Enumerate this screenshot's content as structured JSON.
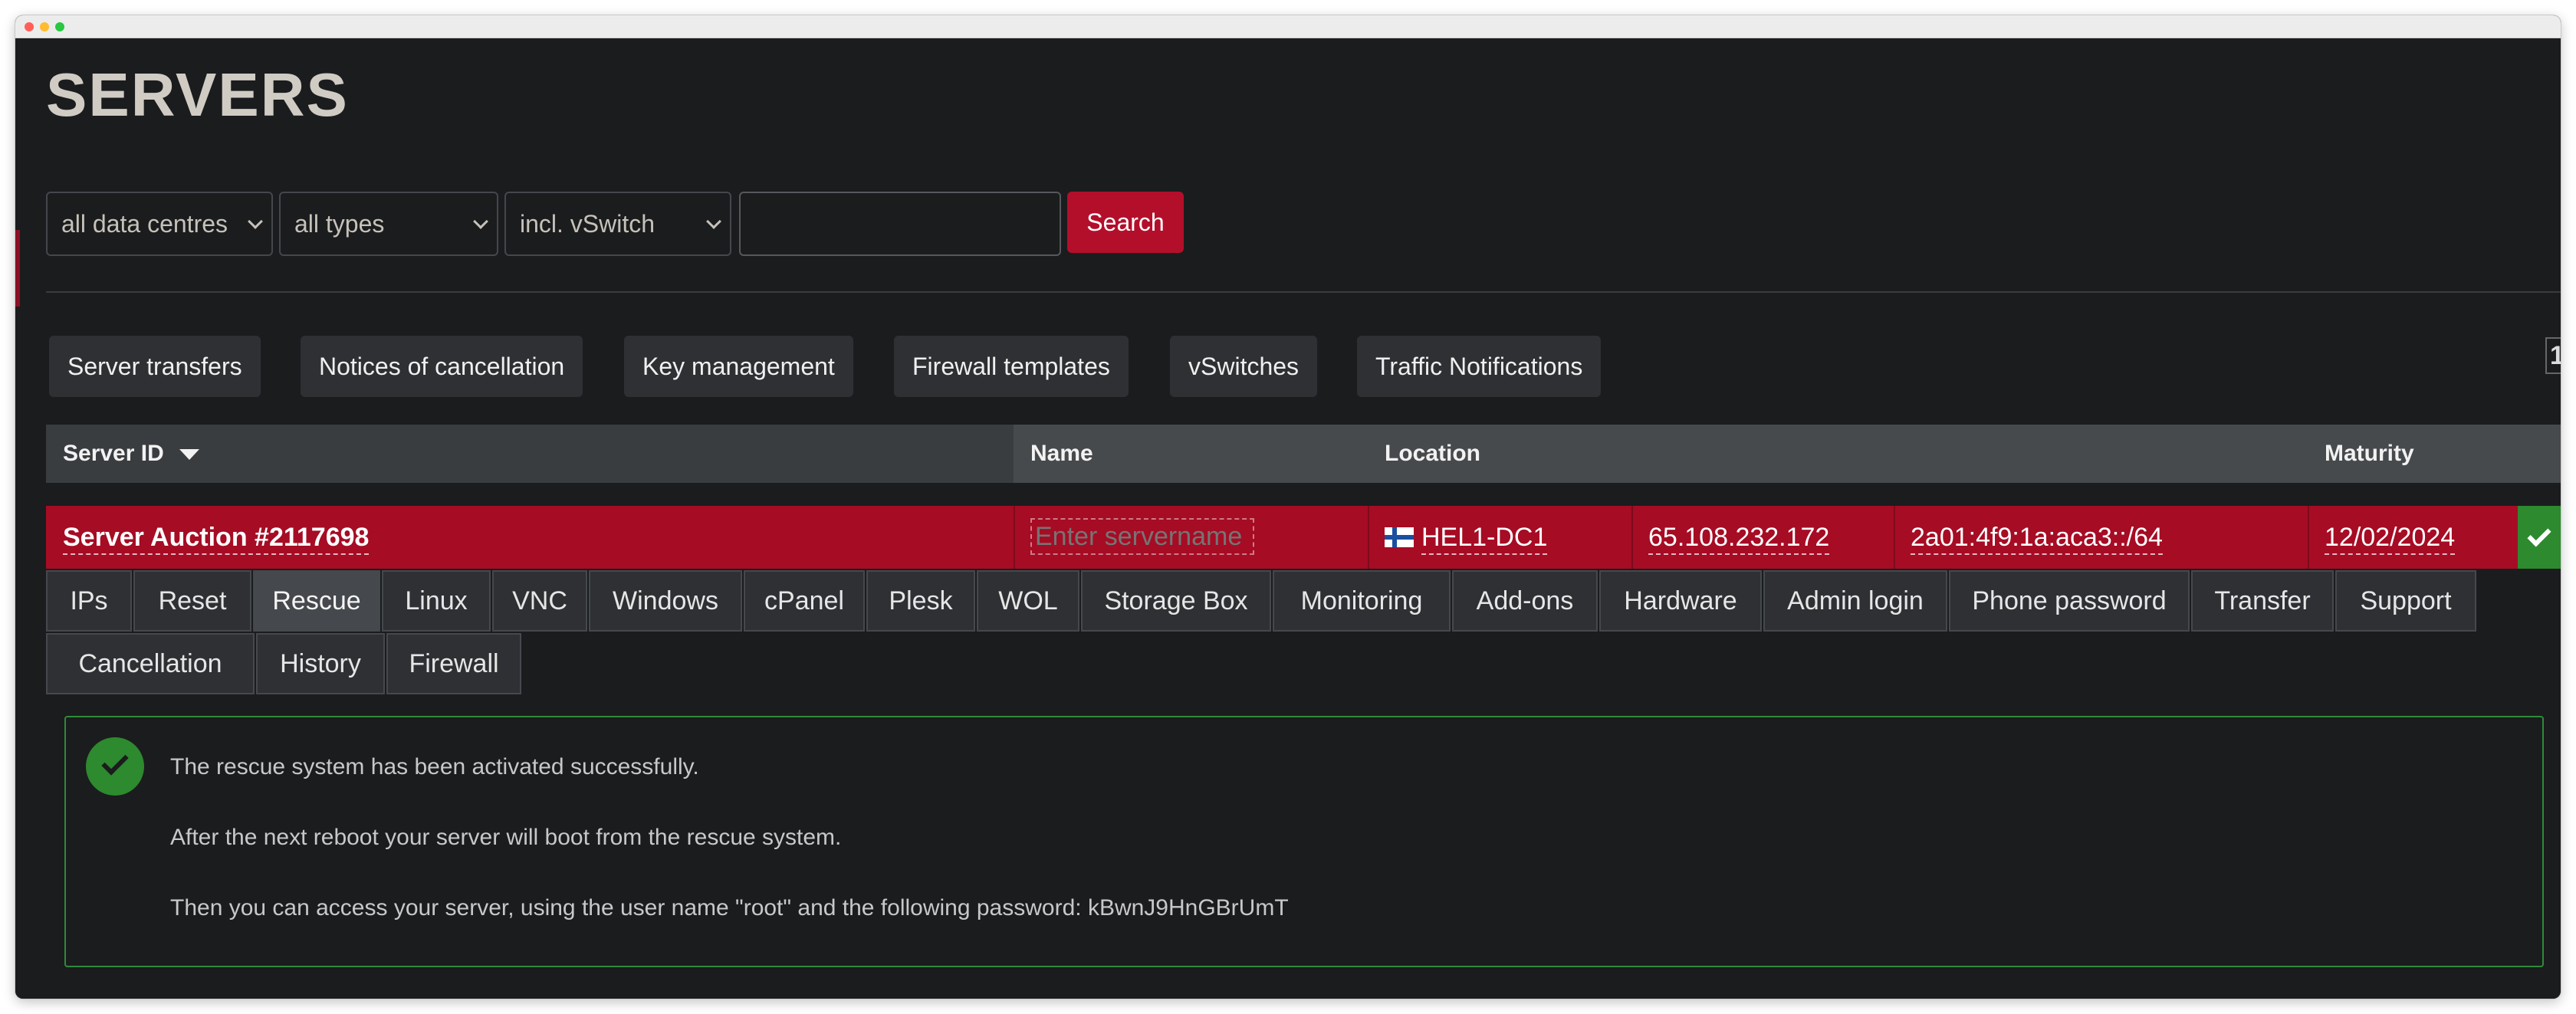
{
  "page": {
    "title": "SERVERS"
  },
  "filters": {
    "data_centre": "all data centres",
    "type": "all types",
    "vswitch": "incl. vSwitch",
    "search_value": "",
    "search_label": "Search"
  },
  "toolbar": {
    "buttons": [
      "Server transfers",
      "Notices of cancellation",
      "Key management",
      "Firewall templates",
      "vSwitches",
      "Traffic Notifications"
    ],
    "page_number": "1"
  },
  "table": {
    "headers": {
      "server_id": "Server ID",
      "name": "Name",
      "location": "Location",
      "maturity": "Maturity"
    },
    "row": {
      "server_id": "Server Auction #2117698",
      "name_placeholder": "Enter servername",
      "location": "HEL1-DC1",
      "ipv4": "65.108.232.172",
      "ipv6": "2a01:4f9:1a:aca3::/64",
      "maturity": "12/02/2024"
    }
  },
  "tabs": {
    "active": "Rescue",
    "items": [
      "IPs",
      "Reset",
      "Rescue",
      "Linux",
      "VNC",
      "Windows",
      "cPanel",
      "Plesk",
      "WOL",
      "Storage Box",
      "Monitoring",
      "Add-ons",
      "Hardware",
      "Admin login",
      "Phone password",
      "Transfer",
      "Support",
      "Cancellation",
      "History",
      "Firewall"
    ]
  },
  "alert": {
    "lines": [
      "The rescue system has been activated successfully.",
      "After the next reboot your server will boot from the rescue system.",
      "Then you can access your server, using the user name \"root\" and the following password: kBwnJ9HnGBrUmT"
    ]
  },
  "colors": {
    "accent_red": "#a60c24",
    "success_green": "#2d8a2e",
    "background": "#1b1c1e"
  },
  "icons": [
    "sort-down-icon",
    "finland-flag-icon",
    "check-icon",
    "success-check-icon",
    "chevron-down-icon"
  ]
}
